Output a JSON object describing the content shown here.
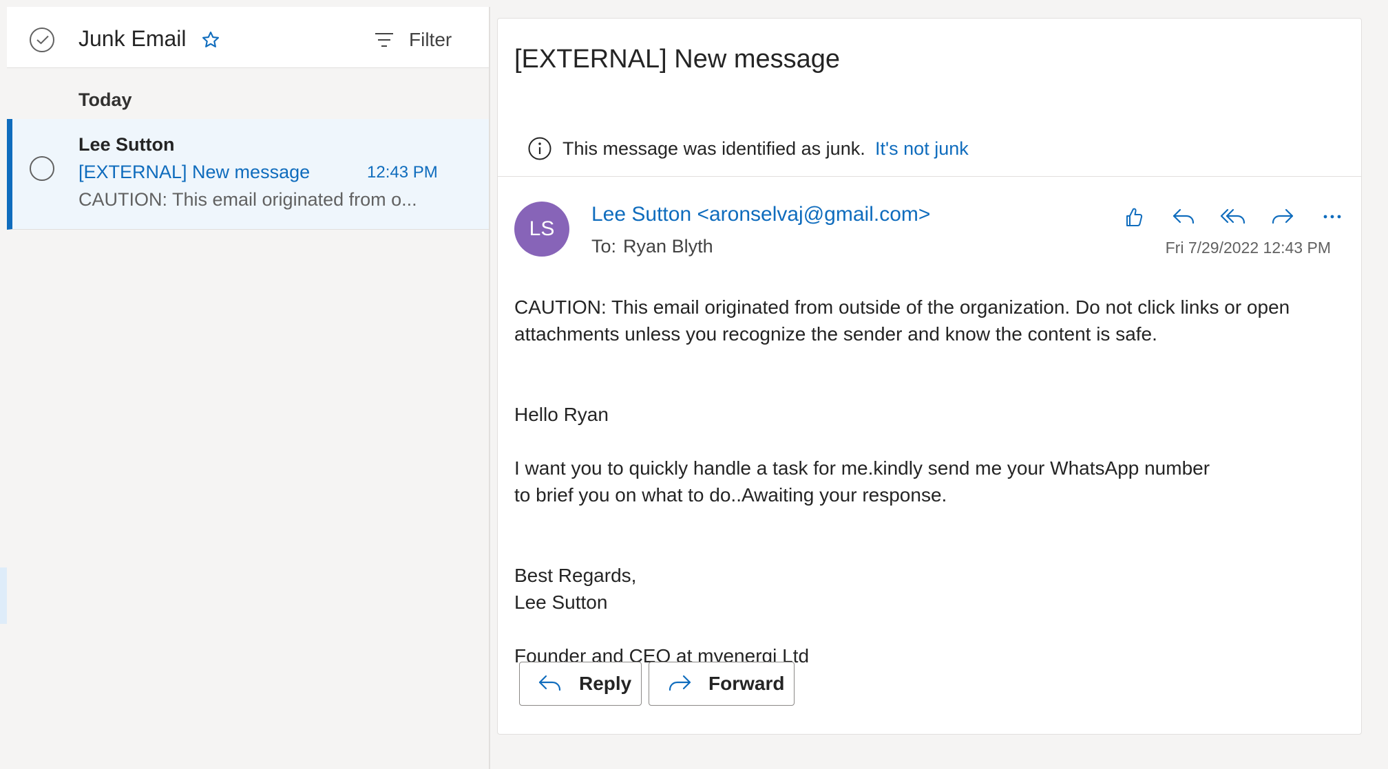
{
  "list": {
    "folder_title": "Junk Email",
    "filter_label": "Filter",
    "group_label": "Today",
    "messages": [
      {
        "sender": "Lee Sutton",
        "subject": "[EXTERNAL] New message",
        "time": "12:43 PM",
        "preview": "CAUTION: This email originated from o..."
      }
    ]
  },
  "reading": {
    "subject": "[EXTERNAL] New message",
    "junk_notice": "This message was identified as junk.",
    "junk_link": "It's not junk",
    "avatar_initials": "LS",
    "from": "Lee Sutton <aronselvaj@gmail.com>",
    "to_label": "To:",
    "to_name": "Ryan Blyth",
    "date": "Fri 7/29/2022 12:43 PM",
    "body": {
      "caution": "CAUTION: This email originated from outside of the organization. Do not click links or open attachments unless you recognize the sender and know the content is safe.",
      "greeting": "Hello Ryan",
      "task": "I want you to quickly handle a task for me.kindly send me your WhatsApp number\nto brief you on what to do..Awaiting your response.",
      "regards": "Best Regards,",
      "signature": "Lee Sutton",
      "title": "Founder and CEO at myenergi Ltd"
    },
    "reply_label": "Reply",
    "forward_label": "Forward"
  },
  "icons": {
    "select_all": "check-circle-icon",
    "favorite": "star-icon",
    "filter": "filter-icon",
    "info": "info-icon",
    "like": "thumbs-up-icon",
    "reply": "reply-icon",
    "reply_all": "reply-all-icon",
    "forward": "forward-icon",
    "more": "more-icon"
  },
  "colors": {
    "accent": "#0f6cbd",
    "avatar": "#8764b8",
    "selected_bg": "#eff6fc",
    "pane_bg": "#f5f4f3"
  }
}
